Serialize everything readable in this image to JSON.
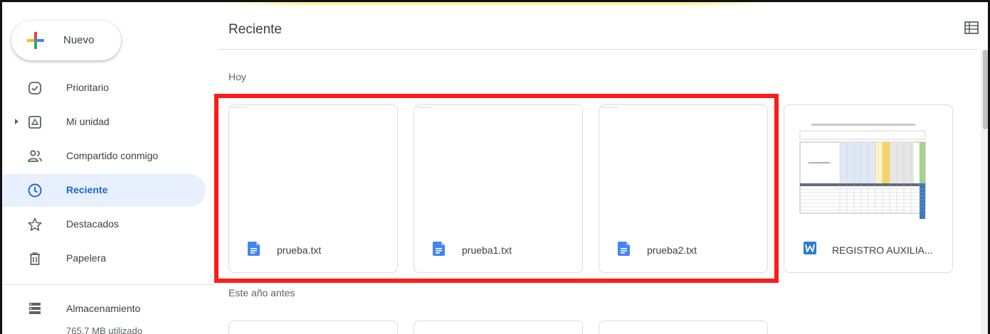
{
  "sidebar": {
    "new_label": "Nuevo",
    "items": [
      {
        "label": "Prioritario",
        "icon": "priority-check-icon"
      },
      {
        "label": "Mi unidad",
        "icon": "my-drive-icon"
      },
      {
        "label": "Compartido conmigo",
        "icon": "shared-people-icon"
      },
      {
        "label": "Reciente",
        "icon": "clock-icon",
        "active": true
      },
      {
        "label": "Destacados",
        "icon": "star-icon"
      },
      {
        "label": "Papelera",
        "icon": "trash-icon"
      }
    ],
    "storage": {
      "label": "Almacenamiento",
      "used": "765,7 MB utilizado"
    }
  },
  "main": {
    "title": "Reciente",
    "sections": [
      {
        "label": "Hoy",
        "files": [
          {
            "name": "prueba.txt",
            "type": "google-doc"
          },
          {
            "name": "prueba1.txt",
            "type": "google-doc"
          },
          {
            "name": "prueba2.txt",
            "type": "google-doc"
          },
          {
            "name": "REGISTRO AUXILIA...",
            "type": "word"
          }
        ]
      },
      {
        "label": "Este año antes"
      }
    ]
  },
  "colors": {
    "accent": "#1967d2",
    "active_bg": "#e8f0fe",
    "highlight": "#ff1a1a",
    "doc_blue": "#4285f4",
    "word_blue": "#2b7cd3"
  }
}
